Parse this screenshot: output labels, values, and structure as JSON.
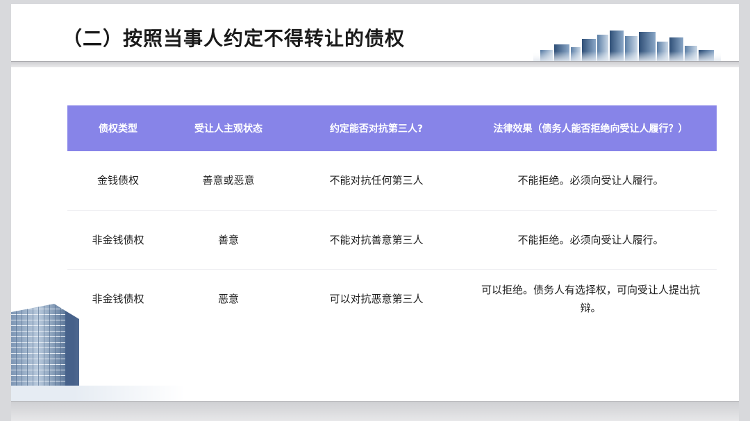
{
  "slide": {
    "title": "（二）按照当事人约定不得转让的债权"
  },
  "table": {
    "headers": [
      "债权类型",
      "受让人主观状态",
      "约定能否对抗第三人?",
      "法律效果（债务人能否拒绝向受让人履行？）"
    ],
    "rows": [
      [
        "金钱债权",
        "善意或恶意",
        "不能对抗任何第三人",
        "不能拒绝。必须向受让人履行。"
      ],
      [
        "非金钱债权",
        "善意",
        "不能对抗善意第三人",
        "不能拒绝。必须向受让人履行。"
      ],
      [
        "非金钱债权",
        "恶意",
        "可以对抗恶意第三人",
        "可以拒绝。债务人有选择权，可向受让人提出抗辩。"
      ]
    ]
  },
  "colors": {
    "header_bg": "#8784e8",
    "header_text": "#ffffff",
    "body_text": "#222222"
  }
}
